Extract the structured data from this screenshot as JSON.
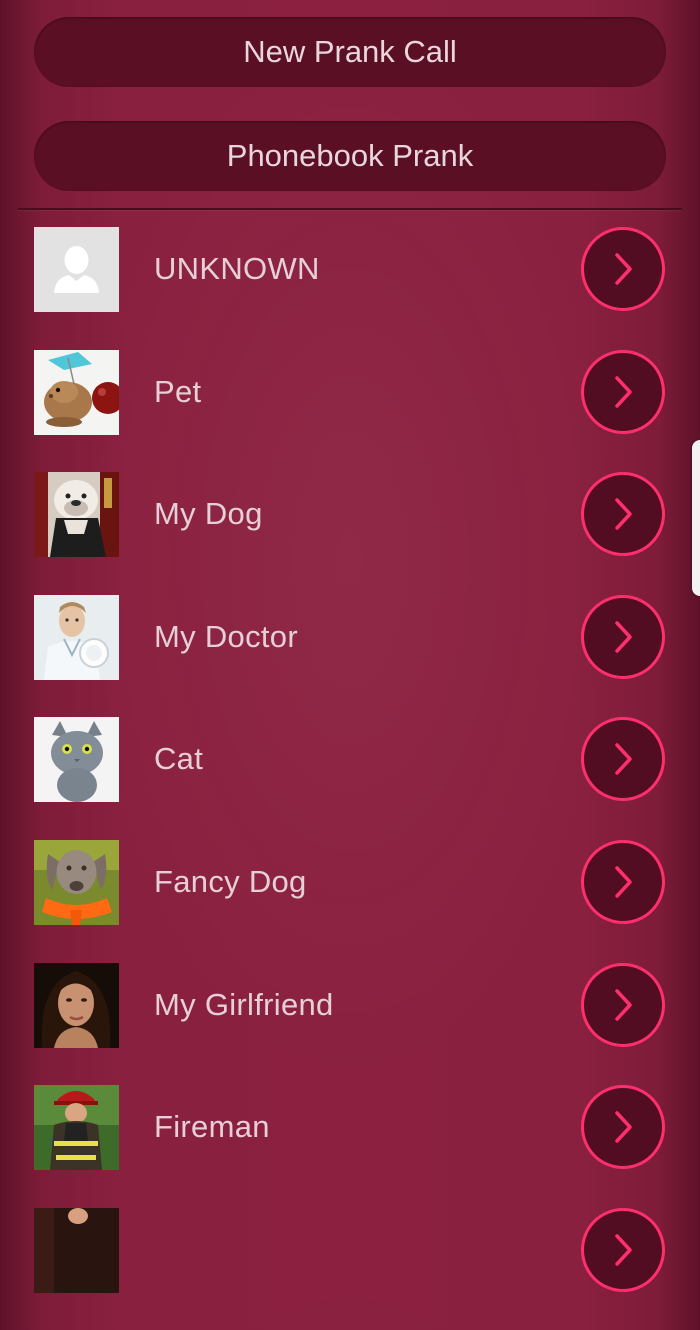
{
  "buttons": {
    "new_prank_call": "New Prank Call",
    "phonebook_prank": "Phonebook Prank"
  },
  "contacts": [
    {
      "name": "UNKNOWN",
      "avatar": "unknown-person-icon"
    },
    {
      "name": "Pet",
      "avatar": "hamster-photo"
    },
    {
      "name": "My Dog",
      "avatar": "bulldog-photo"
    },
    {
      "name": "My Doctor",
      "avatar": "doctor-photo"
    },
    {
      "name": "Cat",
      "avatar": "cat-photo"
    },
    {
      "name": "Fancy Dog",
      "avatar": "weimaraner-scarf-photo"
    },
    {
      "name": "My Girlfriend",
      "avatar": "woman-portrait-photo"
    },
    {
      "name": "Fireman",
      "avatar": "firefighter-photo"
    },
    {
      "name": "",
      "avatar": "partial-photo"
    }
  ],
  "colors": {
    "background": "#8b2040",
    "button_background": "#5a0f25",
    "accent_ring": "#ff2f6e",
    "text": "#e6cfd6"
  }
}
